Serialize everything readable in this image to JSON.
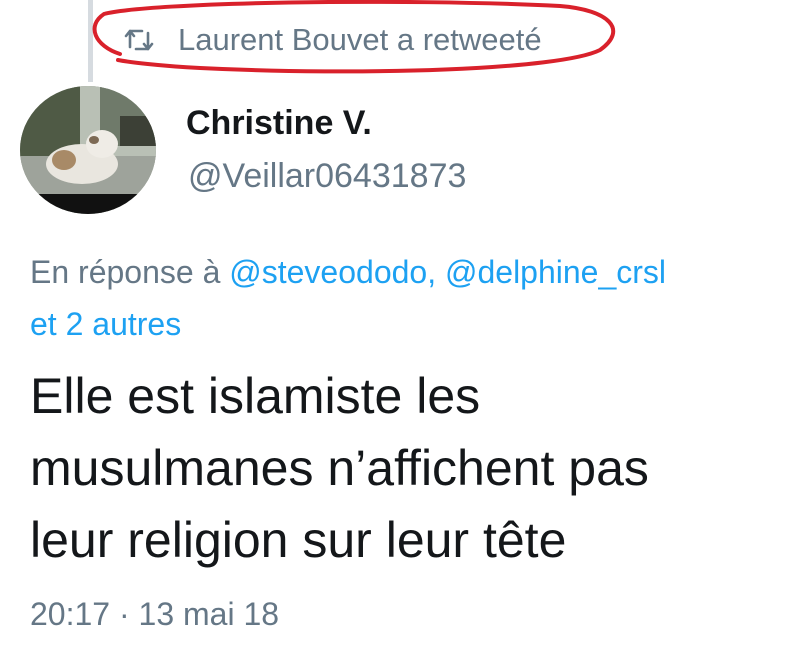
{
  "retweet": {
    "icon": "retweet-icon",
    "text": "Laurent Bouvet a retweeté"
  },
  "author": {
    "display_name": "Christine V.",
    "handle": "@Veillar06431873",
    "avatar_icon": "cat-photo-avatar"
  },
  "reply": {
    "prefix": "En réponse à",
    "mention_1": "@steveododo,",
    "mention_2": "@delphine_crsl",
    "others": "et 2 autres"
  },
  "tweet": {
    "lines": [
      "Elle est islamiste les",
      "musulmanes n’affichent pas",
      "leur religion sur leur tête"
    ]
  },
  "meta": {
    "timestamp": "20:17 · 13 mai 18"
  },
  "colors": {
    "link": "#1da1f2",
    "muted": "#657786",
    "text": "#14171a",
    "annotation": "#d9212b"
  }
}
